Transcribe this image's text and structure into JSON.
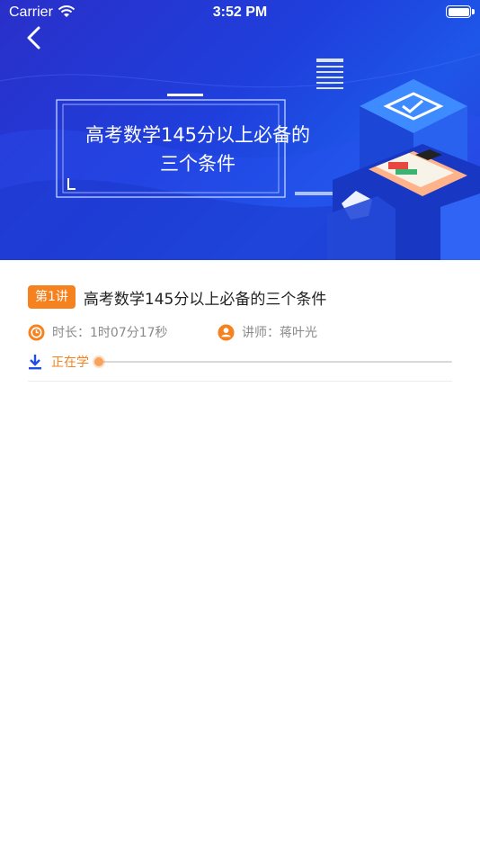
{
  "status_bar": {
    "carrier": "Carrier",
    "time": "3:52 PM"
  },
  "banner": {
    "title": "高考数学145分以上必备的三个条件",
    "title_lines": [
      "高考数学145分以上必备的",
      "三个条件"
    ],
    "bg_color_start": "#2a2fc9",
    "bg_color_end": "#1e56e8"
  },
  "lesson": {
    "badge": "第1讲",
    "title": "高考数学145分以上必备的三个条件",
    "duration": "时长：1时07分17秒",
    "teacher": "讲师：蒋叶光",
    "status": "正在学",
    "progress": 0,
    "accent_color": "#f5821f"
  },
  "icons": {
    "back": "chevron-left-icon",
    "wifi": "wifi-icon",
    "battery": "battery-icon",
    "duration": "clock-icon",
    "teacher": "user-icon",
    "download": "download-icon",
    "illustration": "isometric-books-illustration"
  }
}
